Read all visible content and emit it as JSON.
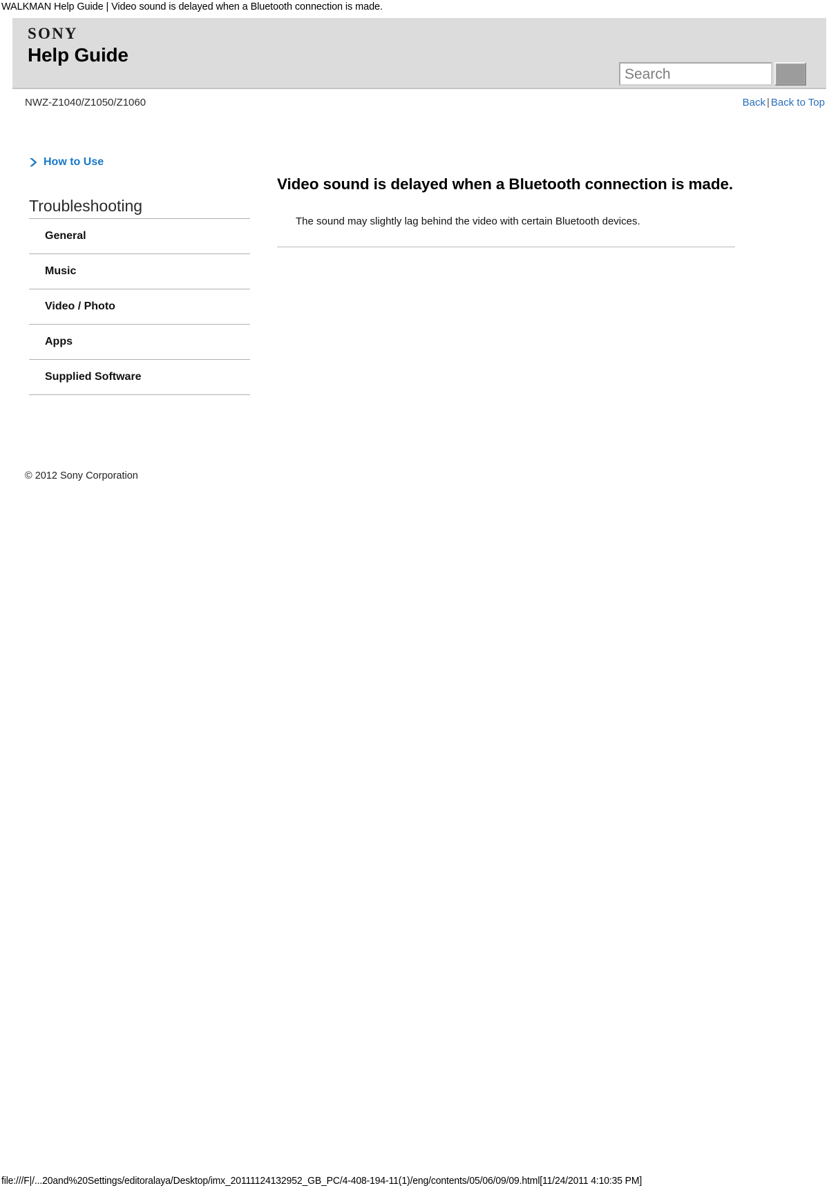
{
  "browser": {
    "page_title": "WALKMAN Help Guide | Video sound is delayed when a Bluetooth connection is made.",
    "footer_url": "file:///F|/...20and%20Settings/editoralaya/Desktop/imx_20111124132952_GB_PC/4-408-194-11(1)/eng/contents/05/06/09/09.html[11/24/2011 4:10:35 PM]"
  },
  "header": {
    "brand": "SONY",
    "title": "Help Guide",
    "search": {
      "placeholder": "Search",
      "value": "",
      "button_label": ""
    }
  },
  "model_row": {
    "model_number": "NWZ-Z1040/Z1050/Z1060",
    "back_link": "Back",
    "separator": "|",
    "back_to_top_link": "Back to Top"
  },
  "sidebar": {
    "how_to_use": {
      "label": "How to Use",
      "icon": "chevron-right-icon"
    },
    "section_title": "Troubleshooting",
    "items": [
      {
        "label": "General"
      },
      {
        "label": "Music"
      },
      {
        "label": "Video / Photo"
      },
      {
        "label": "Apps"
      },
      {
        "label": "Supplied Software"
      }
    ],
    "copyright": "© 2012 Sony Corporation"
  },
  "main": {
    "heading": "Video sound is delayed when a Bluetooth connection is made.",
    "body": "The sound may slightly lag behind the video with certain Bluetooth devices."
  },
  "colors": {
    "header_band": "#dcdcdc",
    "link_blue": "#2a6ebb",
    "accent_blue": "#1878c8",
    "rule_gray": "#b0b0b0"
  }
}
